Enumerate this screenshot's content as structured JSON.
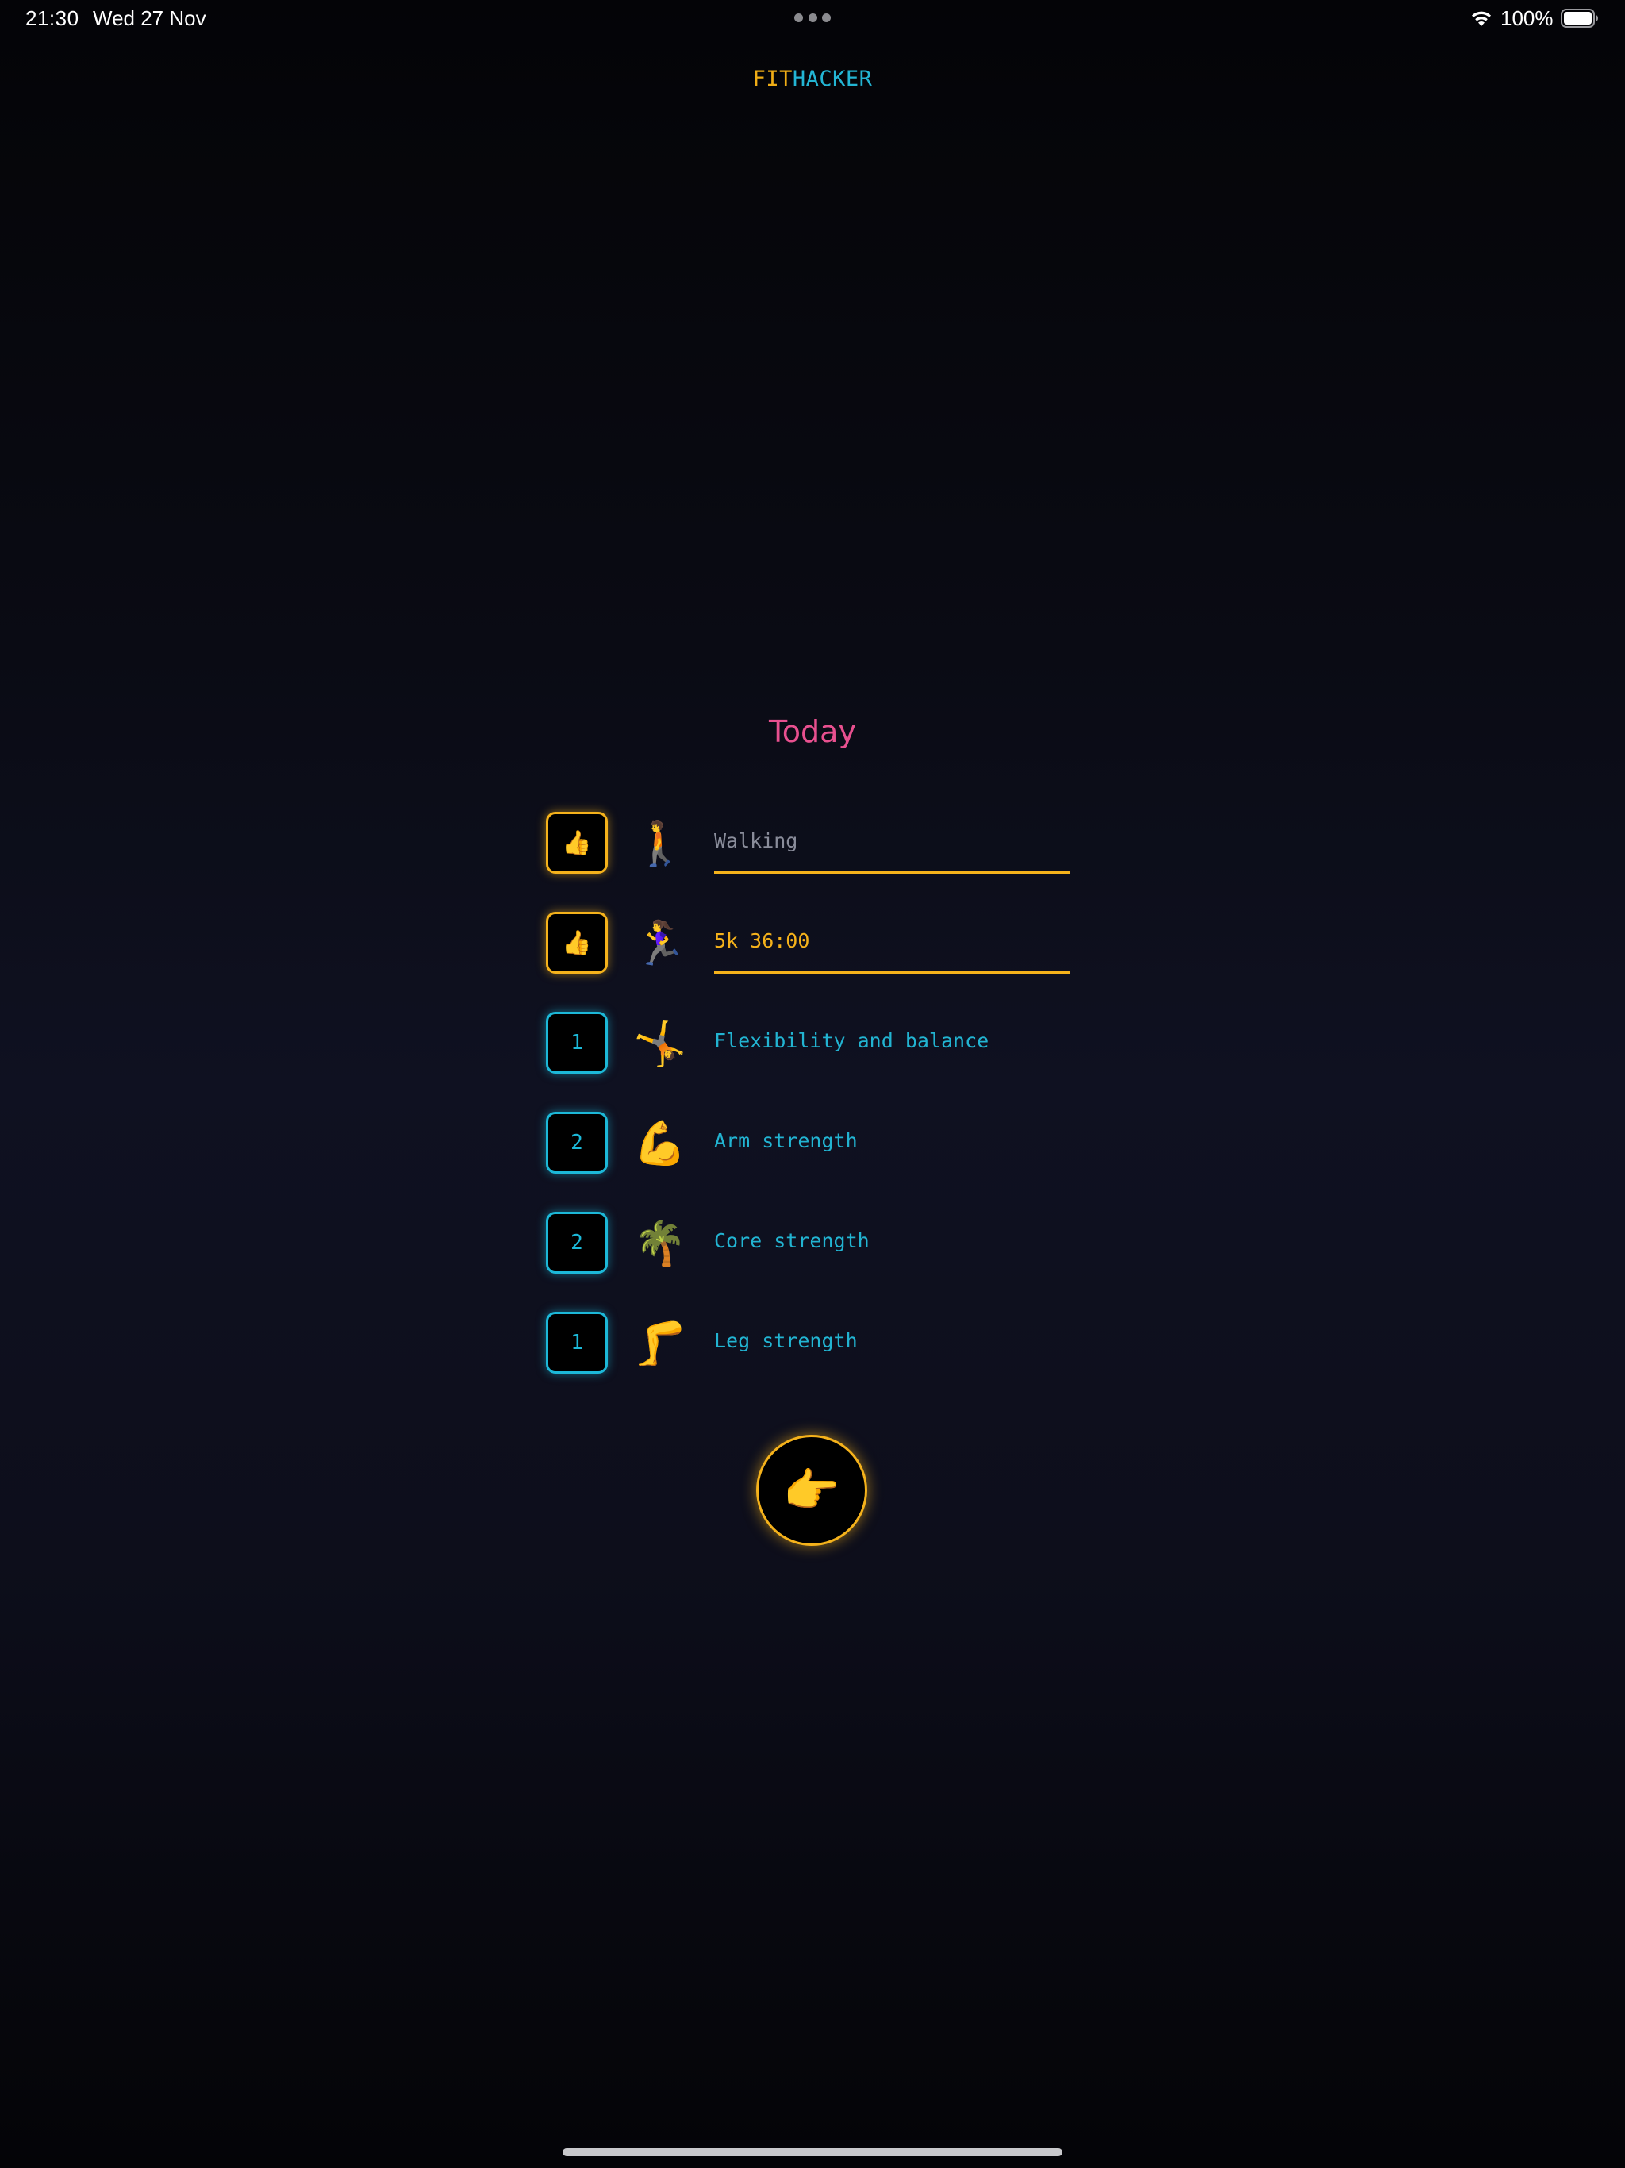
{
  "status_bar": {
    "time": "21:30",
    "date": "Wed 27 Nov",
    "battery_percent": "100%",
    "battery_level": 1.0
  },
  "brand": {
    "part1": "FIT",
    "part2": "HACKER"
  },
  "heading": "Today",
  "items": [
    {
      "status": "👍",
      "status_type": "done",
      "emoji": "🚶",
      "text": "Walking",
      "kind": "input",
      "is_placeholder": true
    },
    {
      "status": "👍",
      "status_type": "done",
      "emoji": "🏃‍♀️",
      "text": "5k 36:00",
      "kind": "input",
      "is_placeholder": false
    },
    {
      "status": "1",
      "status_type": "count",
      "emoji": "🤸",
      "text": "Flexibility and balance",
      "kind": "label"
    },
    {
      "status": "2",
      "status_type": "count",
      "emoji": "💪",
      "text": "Arm strength",
      "kind": "label"
    },
    {
      "status": "2",
      "status_type": "count",
      "emoji": "🌴",
      "text": "Core strength",
      "kind": "label"
    },
    {
      "status": "1",
      "status_type": "count",
      "emoji": "🦵",
      "text": "Leg strength",
      "kind": "label"
    }
  ],
  "next_button": {
    "emoji": "👉"
  },
  "colors": {
    "gold": "#f5b21b",
    "cyan": "#1cb8d8",
    "pink": "#e8508f",
    "background": "#0f1121"
  },
  "icons": {
    "wifi": "wifi-icon",
    "battery": "battery-icon",
    "multitask": "multitasking-dots-icon"
  }
}
